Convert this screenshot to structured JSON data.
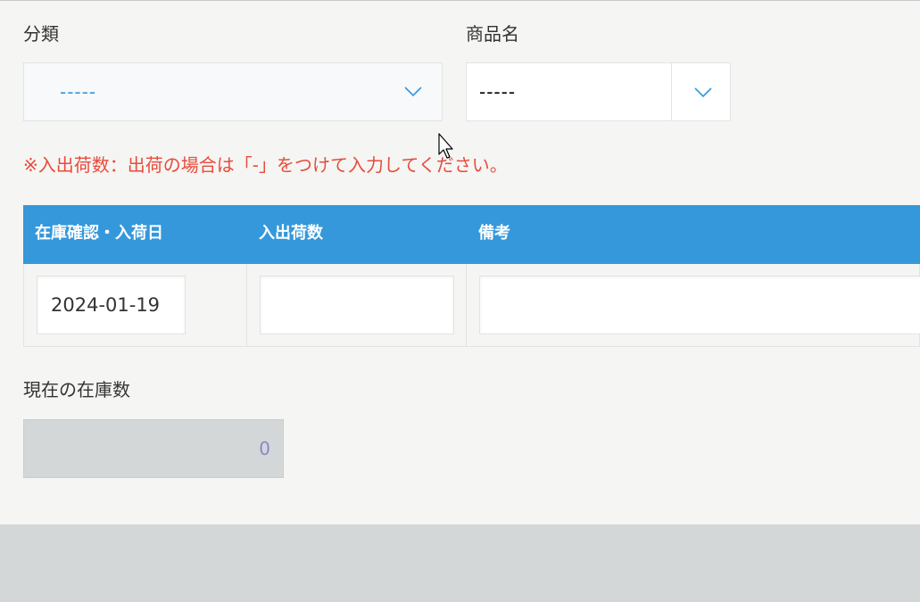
{
  "form": {
    "category": {
      "label": "分類",
      "value": "-----"
    },
    "product": {
      "label": "商品名",
      "value": "-----"
    },
    "note": "※入出荷数：出荷の場合は「-」をつけて入力してください。",
    "table": {
      "headers": [
        "在庫確認・入荷日",
        "入出荷数",
        "備考"
      ],
      "row": {
        "date": "2024-01-19",
        "quantity": "",
        "remarks": ""
      }
    },
    "stock": {
      "label": "現在の在庫数",
      "value": "0"
    }
  },
  "colors": {
    "accent": "#3498db",
    "note": "#e74c3c",
    "background": "#f5f5f3",
    "footer": "#d4d7d8"
  },
  "icons": {
    "dropdown": "chevron-down-icon",
    "cursor": "mouse-pointer-icon"
  }
}
